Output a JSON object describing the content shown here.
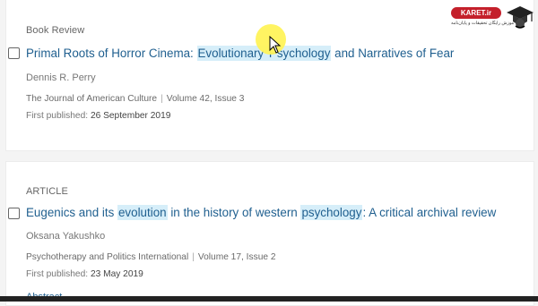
{
  "results": [
    {
      "type": "Book Review",
      "title_parts": [
        "Primal Roots of Horror Cinema: ",
        "Evolutionary ",
        " ",
        "Psychology",
        " and Narratives of Fear"
      ],
      "author": "Dennis R. Perry",
      "journal": "The Journal of American Culture",
      "volume": "Volume 42, Issue 3",
      "pub_label": "First published:",
      "pub_date": "26 September 2019"
    },
    {
      "type": "ARTICLE",
      "title_parts": [
        "Eugenics and its ",
        "evolution",
        " in the history of western ",
        "psychology",
        ": A critical archival review"
      ],
      "author": "Oksana Yakushko",
      "journal": "Psychotherapy and Politics International",
      "volume": "Volume 17, Issue 2",
      "pub_label": "First published:",
      "pub_date": "23 May 2019",
      "abstract_label": "Abstract"
    }
  ],
  "separator": "|",
  "logo": {
    "badge": "KARET.ir",
    "subtitle": "آموزش رایگان تحقیقات و پایان‌نامه"
  },
  "colors": {
    "link": "#1f5f8f",
    "highlight": "#d6eef9",
    "logo_red": "#c4202b",
    "cursor_highlight": "#fff35a"
  }
}
